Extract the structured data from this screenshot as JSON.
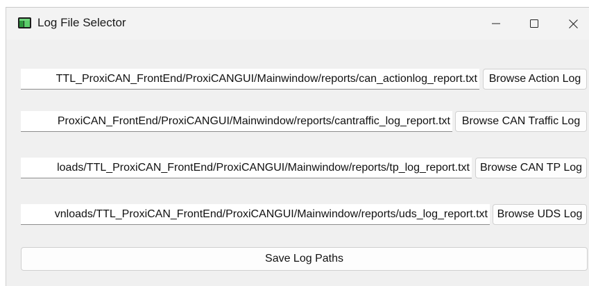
{
  "window": {
    "title": "Log File Selector",
    "controls": {
      "minimize_icon": "minimize-icon",
      "maximize_icon": "maximize-icon",
      "close_icon": "close-icon"
    }
  },
  "rows": [
    {
      "path": "TTL_ProxiCAN_FrontEnd/ProxiCANGUI/Mainwindow/reports/can_actionlog_report.txt",
      "button_label": "Browse Action Log"
    },
    {
      "path": "ProxiCAN_FrontEnd/ProxiCANGUI/Mainwindow/reports/cantraffic_log_report.txt",
      "button_label": "Browse CAN Traffic Log"
    },
    {
      "path": "loads/TTL_ProxiCAN_FrontEnd/ProxiCANGUI/Mainwindow/reports/tp_log_report.txt",
      "button_label": "Browse CAN TP Log"
    },
    {
      "path": "vnloads/TTL_ProxiCAN_FrontEnd/ProxiCANGUI/Mainwindow/reports/uds_log_report.txt",
      "button_label": "Browse UDS Log"
    }
  ],
  "save_button": {
    "label": "Save Log Paths"
  },
  "colors": {
    "window_bg": "#f0f0f0",
    "titlebar_bg": "#f3f3f3",
    "field_bg": "#ffffff",
    "button_bg": "#fdfdfd"
  }
}
